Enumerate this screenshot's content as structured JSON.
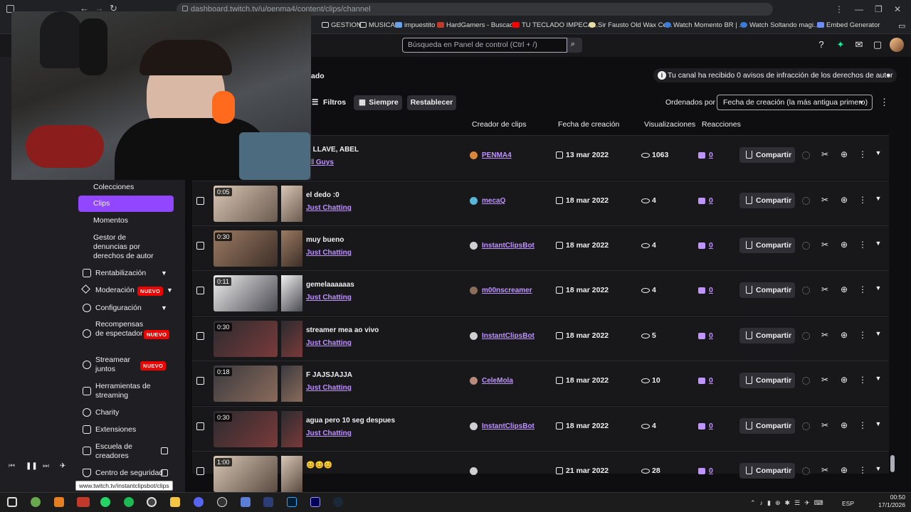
{
  "browser": {
    "url": "dashboard.twitch.tv/u/penma4/content/clips/channel",
    "bookmarks": [
      "GESTION",
      "MUSICA",
      "impuestito",
      "HardGamers - Buscad...",
      "TU TECLADO IMPECA...",
      "Sir Fausto Old Wax Ce...",
      "Watch Momento BR | ...",
      "Watch Soltando magi...",
      "Embed Generator"
    ],
    "status_url": "www.twitch.tv/instantclipsbot/clips"
  },
  "topnav": {
    "search_placeholder": "Búsqueda en Panel de control (Ctrl + /)"
  },
  "sidebar": {
    "items": [
      {
        "label": "Colecciones"
      },
      {
        "label": "Clips",
        "active": true
      },
      {
        "label": "Momentos"
      },
      {
        "label": "Gestor de denuncias por derechos de autor"
      },
      {
        "label": "Rentabilización"
      },
      {
        "label": "Moderación",
        "badge": "NUEVO"
      },
      {
        "label": "Configuración"
      },
      {
        "label": "Recompensas de espectador",
        "badge": "NUEVO"
      },
      {
        "label": "Streamear juntos",
        "badge": "NUEVO"
      },
      {
        "label": "Herramientas de streaming"
      },
      {
        "label": "Charity"
      },
      {
        "label": "Extensiones"
      },
      {
        "label": "Escuela de creadores"
      },
      {
        "label": "Centro de seguridad"
      }
    ]
  },
  "main": {
    "heading_fragment": "ado",
    "notice": "Tu canal ha recibido 0 avisos de infracción de los derechos de autor",
    "filters_label": "Filtros",
    "period_label": "Siempre",
    "reset_label": "Restablecer",
    "sort_label": "Ordenados por",
    "sort_value": "Fecha de creación (la más antigua primero)",
    "columns": [
      "Creador de clips",
      "Fecha de creación",
      "Visualizaciones",
      "Reacciones"
    ],
    "share_label": "Compartir",
    "rows": [
      {
        "duration": "",
        "title": "A LLAVE, ABEL",
        "game": "all Guys",
        "creator": "PENMA4",
        "date": "13 mar 2022",
        "views": "1063",
        "reactions": "0"
      },
      {
        "duration": "0:05",
        "title": "el dedo :0",
        "game": "Just Chatting",
        "creator": "mecaQ",
        "date": "18 mar 2022",
        "views": "4",
        "reactions": "0"
      },
      {
        "duration": "0:30",
        "title": "muy bueno",
        "game": "Just Chatting",
        "creator": "InstantClipsBot",
        "date": "18 mar 2022",
        "views": "4",
        "reactions": "0"
      },
      {
        "duration": "0:11",
        "title": "gemelaaaaaas",
        "game": "Just Chatting",
        "creator": "m00nscreamer",
        "date": "18 mar 2022",
        "views": "4",
        "reactions": "0"
      },
      {
        "duration": "0:30",
        "title": "streamer mea ao vivo",
        "game": "Just Chatting",
        "creator": "InstantClipsBot",
        "date": "18 mar 2022",
        "views": "5",
        "reactions": "0"
      },
      {
        "duration": "0:18",
        "title": "F JAJSJAJJA",
        "game": "Just Chatting",
        "creator": "CeleMola",
        "date": "18 mar 2022",
        "views": "10",
        "reactions": "0"
      },
      {
        "duration": "0:30",
        "title": "agua pero 10 seg despues",
        "game": "Just Chatting",
        "creator": "InstantClipsBot",
        "date": "18 mar 2022",
        "views": "4",
        "reactions": "0"
      },
      {
        "duration": "1:00",
        "title": "😊😊😊",
        "game": "",
        "creator": "",
        "date": "21 mar 2022",
        "views": "28",
        "reactions": "0"
      }
    ]
  },
  "taskbar": {
    "lang": "ESP",
    "time": "00:50",
    "date": "17/1/2026"
  },
  "colors": {
    "accent": "#9147ff",
    "link": "#bf94ff",
    "badge": "#eb0400"
  }
}
